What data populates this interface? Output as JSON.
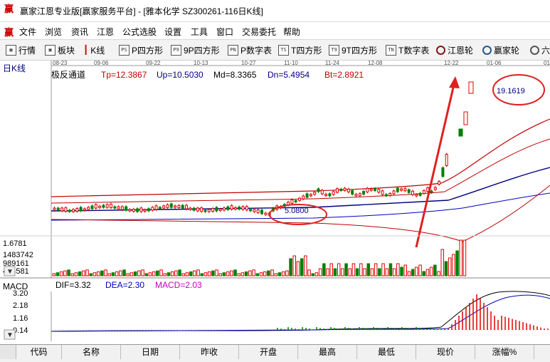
{
  "window": {
    "title": "赢家江恩专业版[赢家服务平台] - [雅本化学  SZ300261-116日K线]",
    "logo_char": "赢"
  },
  "menu": [
    "文件",
    "浏览",
    "资讯",
    "江恩",
    "公式选股",
    "设置",
    "工具",
    "窗口",
    "交易委托",
    "帮助"
  ],
  "toolbar": [
    {
      "label": "行情",
      "icon": "grid-icon"
    },
    {
      "label": "板块",
      "icon": "blocks-icon"
    },
    {
      "label": "K线",
      "icon": "candle-icon"
    },
    {
      "label": "P四方形",
      "icon": "p-square-icon",
      "code": "PS"
    },
    {
      "label": "9P四方形",
      "icon": "9p-square-icon",
      "code": "P9"
    },
    {
      "label": "P数字表",
      "icon": "pn-table-icon",
      "code": "PN"
    },
    {
      "label": "T四方形",
      "icon": "t-square-icon",
      "code": "TS"
    },
    {
      "label": "9T四方形",
      "icon": "9t-square-icon",
      "code": "T9"
    },
    {
      "label": "T数字表",
      "icon": "tn-table-icon",
      "code": "TN"
    },
    {
      "label": "江恩轮",
      "icon": "gann-wheel-icon"
    },
    {
      "label": "赢家轮",
      "icon": "winner-wheel-icon"
    },
    {
      "label": "六",
      "icon": "six-icon"
    }
  ],
  "chart": {
    "period_label": "日K线",
    "dates": [
      "08-23",
      "09-06",
      "09-22",
      "10-13",
      "10-27",
      "11-10",
      "11-24",
      "12-08",
      "12-22",
      "01-06",
      "01-"
    ],
    "indicator": {
      "name": "极反通道",
      "tp": "Tp=12.3867",
      "up": "Up=10.5030",
      "md": "Md=8.3365",
      "dn": "Dn=5.4954",
      "bt": "Bt=2.8921"
    },
    "low_price_label": "5.0800",
    "high_price_label": "19.1619",
    "volume_labels": [
      "1.6781",
      "1483742",
      "989161",
      "494581"
    ],
    "macd": {
      "title": "MACD",
      "dif": "DIF=3.32",
      "dea": "DEA=2.30",
      "macd": "MACD=2.03",
      "axis": [
        "3.20",
        "2.18",
        "1.16",
        "0.14"
      ]
    },
    "colors": {
      "up": "#e00000",
      "down": "#008000",
      "channel_outer": "#c00000",
      "channel_mid": "#000080",
      "annotation": "#e02020",
      "dif": "#000000",
      "dea": "#0000c0",
      "macd_label": "#c000c0"
    }
  },
  "table": {
    "headers": [
      "代码",
      "名称",
      "日期",
      "昨收",
      "开盘",
      "最高",
      "最低",
      "现价",
      "涨幅%"
    ]
  }
}
